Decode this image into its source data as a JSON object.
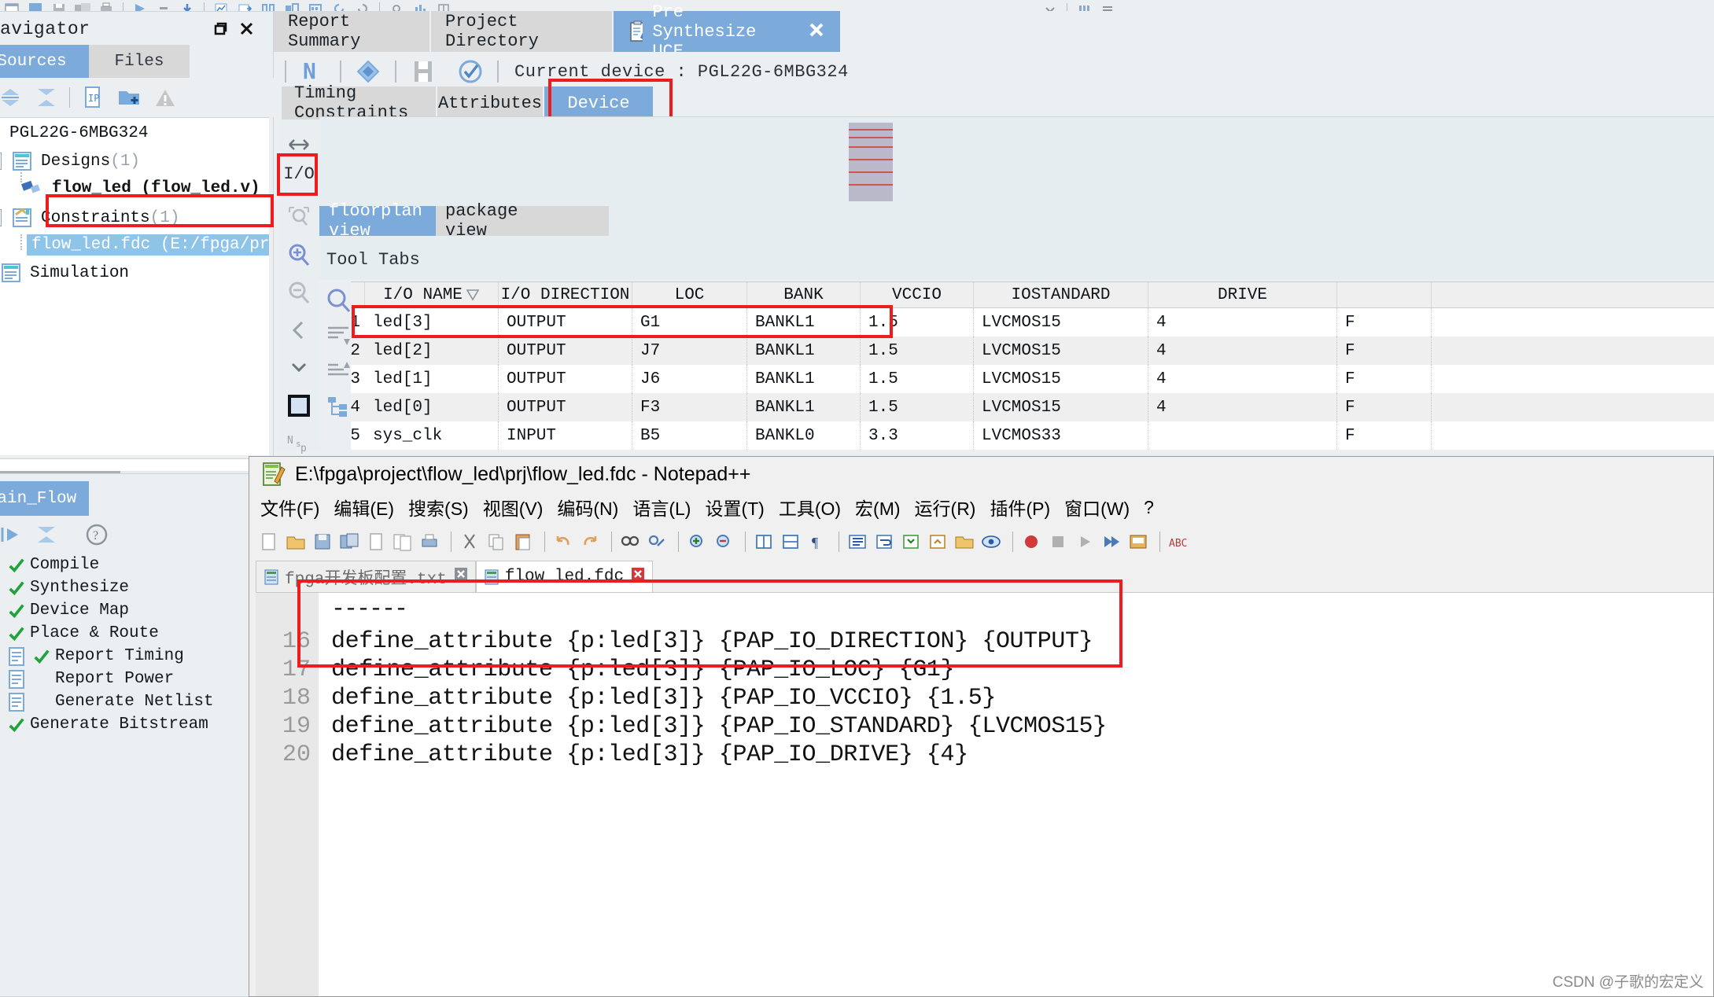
{
  "navigator": {
    "title": "avigator",
    "tabs": [
      {
        "label": "Sources",
        "active": true
      },
      {
        "label": "Files",
        "active": false
      }
    ],
    "tree": [
      {
        "label": "PGL22G-6MBG324",
        "kind": "device"
      },
      {
        "label": "Designs",
        "count": "(1)",
        "kind": "group"
      },
      {
        "label": "flow_led (flow_led.v)",
        "kind": "file-bold"
      },
      {
        "label": "Constraints",
        "count": "(1)",
        "kind": "group"
      },
      {
        "label": "flow_led.fdc (E:/fpga/proj",
        "kind": "file-selected"
      },
      {
        "label": "Simulation",
        "kind": "group"
      }
    ]
  },
  "flow_panel": {
    "tab_label": "Main_Flow",
    "items": [
      {
        "label": "Compile",
        "checked": true,
        "indent": false
      },
      {
        "label": "Synthesize",
        "checked": true,
        "indent": false
      },
      {
        "label": "Device Map",
        "checked": true,
        "indent": false
      },
      {
        "label": "Place & Route",
        "checked": true,
        "indent": false
      },
      {
        "label": "Report Timing",
        "checked": true,
        "indent": true
      },
      {
        "label": "Report Power",
        "checked": false,
        "indent": true
      },
      {
        "label": "Generate Netlist",
        "checked": false,
        "indent": true
      },
      {
        "label": "Generate Bitstream",
        "checked": false,
        "indent": false
      }
    ]
  },
  "main": {
    "tabs": [
      {
        "label": "Report Summary",
        "active": false,
        "icon": null,
        "closable": false
      },
      {
        "label": "Project Directory",
        "active": false,
        "icon": null,
        "closable": false
      },
      {
        "label": "Pre Synthesize UCE",
        "active": true,
        "icon": "clipboard-pen-icon",
        "closable": true
      }
    ],
    "device_bar": {
      "label": "Current device : PGL22G-6MBG324"
    },
    "sub_tabs": [
      {
        "label": "Timing Constraints",
        "active": false
      },
      {
        "label": "Attributes",
        "active": false
      },
      {
        "label": "Device",
        "active": true
      }
    ],
    "view_tabs": [
      {
        "label": "floorplan view",
        "active": true
      },
      {
        "label": "package view",
        "active": false
      }
    ],
    "tool_tabs_label": "Tool Tabs",
    "io_button_label": "I/O"
  },
  "table": {
    "columns": [
      "",
      "I/O NAME",
      "I/O DIRECTION",
      "LOC",
      "BANK",
      "VCCIO",
      "IOSTANDARD",
      "DRIVE",
      ""
    ],
    "sort_indicator_column": "I/O NAME",
    "rows": [
      {
        "num": "1",
        "name": "led[3]",
        "direction": "OUTPUT",
        "loc": "G1",
        "bank": "BANKL1",
        "vccio": "1.5",
        "iostandard": "LVCMOS15",
        "drive": "4",
        "ext": "F"
      },
      {
        "num": "2",
        "name": "led[2]",
        "direction": "OUTPUT",
        "loc": "J7",
        "bank": "BANKL1",
        "vccio": "1.5",
        "iostandard": "LVCMOS15",
        "drive": "4",
        "ext": "F"
      },
      {
        "num": "3",
        "name": "led[1]",
        "direction": "OUTPUT",
        "loc": "J6",
        "bank": "BANKL1",
        "vccio": "1.5",
        "iostandard": "LVCMOS15",
        "drive": "4",
        "ext": "F"
      },
      {
        "num": "4",
        "name": "led[0]",
        "direction": "OUTPUT",
        "loc": "F3",
        "bank": "BANKL1",
        "vccio": "1.5",
        "iostandard": "LVCMOS15",
        "drive": "4",
        "ext": "F"
      },
      {
        "num": "5",
        "name": "sys_clk",
        "direction": "INPUT",
        "loc": "B5",
        "bank": "BANKL0",
        "vccio": "3.3",
        "iostandard": "LVCMOS33",
        "drive": "",
        "ext": "F"
      }
    ]
  },
  "notepad": {
    "title": "E:\\fpga\\project\\flow_led\\prj\\flow_led.fdc - Notepad++",
    "menu": [
      "文件(F)",
      "编辑(E)",
      "搜索(S)",
      "视图(V)",
      "编码(N)",
      "语言(L)",
      "设置(T)",
      "工具(O)",
      "宏(M)",
      "运行(R)",
      "插件(P)",
      "窗口(W)",
      "?"
    ],
    "tabs": [
      {
        "label": "fpga开发板配置.txt",
        "active": false
      },
      {
        "label": "flow_led.fdc",
        "active": true
      }
    ],
    "dash_line": "------",
    "lines": [
      {
        "no": "16",
        "text": "define_attribute {p:led[3]} {PAP_IO_DIRECTION} {OUTPUT}"
      },
      {
        "no": "17",
        "text": "define_attribute {p:led[3]} {PAP_IO_LOC} {G1}"
      },
      {
        "no": "18",
        "text": "define_attribute {p:led[3]} {PAP_IO_VCCIO} {1.5}"
      },
      {
        "no": "19",
        "text": "define_attribute {p:led[3]} {PAP_IO_STANDARD} {LVCMOS15}"
      },
      {
        "no": "20",
        "text": "define_attribute {p:led[3]} {PAP_IO_DRIVE} {4}"
      }
    ],
    "watermark": "CSDN @子歌的宏定义"
  },
  "colors": {
    "accent_blue": "#7cabdb",
    "selection_blue": "#8ec4e8",
    "annotation_red": "#ee1c1c",
    "panel_bg": "#eceff1",
    "tab_bg": "#d8d8d8"
  }
}
